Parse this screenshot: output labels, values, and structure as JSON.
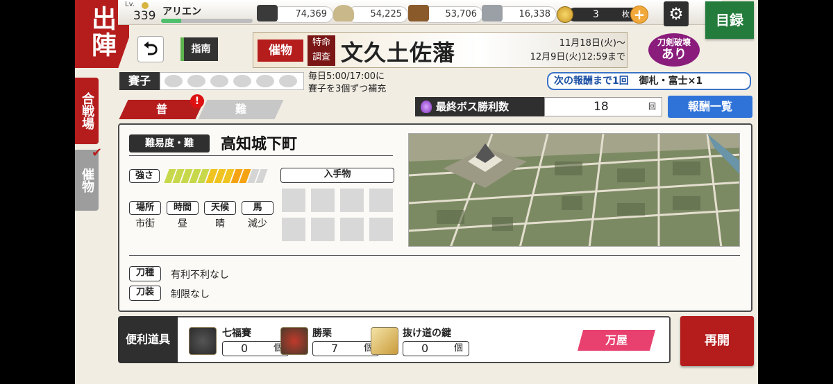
{
  "sidebar": {
    "sortie_label": "出陣",
    "tab_kassenba": "合戦場",
    "tab_saiji": "催物"
  },
  "player": {
    "lv_label": "Lv.",
    "level": "339",
    "name": "アリエン",
    "xp_fraction": 0.22
  },
  "resources": [
    {
      "icon": "charcoal-icon",
      "value": "74,369",
      "color": "#3a3a3a"
    },
    {
      "icon": "tamahagane-icon",
      "value": "54,225",
      "color": "#c9b88a"
    },
    {
      "icon": "cooling-material-icon",
      "value": "53,706",
      "color": "#8b5a2b"
    },
    {
      "icon": "whetstone-icon",
      "value": "16,338",
      "color": "#9aa0a6"
    }
  ],
  "koban": {
    "value": "3",
    "unit": "枚"
  },
  "header": {
    "catalog_label": "目録"
  },
  "nav": {
    "guide_label": "指南"
  },
  "event_banner": {
    "tag": "催物",
    "subtag_line1": "特命",
    "subtag_line2": "調査",
    "title": "文久土佐藩",
    "date_line1": "11月18日(火)〜",
    "date_line2": "12月9日(火)12:59まで"
  },
  "badge": {
    "line1": "刀剣破壊",
    "line2": "あり"
  },
  "saishi": {
    "label": "賽子",
    "count_slots": 6,
    "note_line1": "毎日5:00/17:00に",
    "note_line2": "賽子を3個ずつ補充"
  },
  "reward": {
    "next_label": "次の報酬まで1回",
    "next_item": "御札・富士×1",
    "boss_label": "最終ボス勝利数",
    "boss_value": "18",
    "boss_unit": "回",
    "list_button": "報酬一覧"
  },
  "difficulty_tabs": {
    "normal": "普",
    "hard": "難",
    "alert": "!"
  },
  "stage": {
    "difficulty_label": "難易度・難",
    "name": "高知城下町",
    "strength_label": "強さ",
    "strength_level": 0.8,
    "conditions": [
      {
        "label": "場所",
        "value": "市街"
      },
      {
        "label": "時間",
        "value": "昼"
      },
      {
        "label": "天候",
        "value": "晴"
      },
      {
        "label": "馬",
        "value": "減少"
      }
    ],
    "loot_label": "入手物",
    "sword_type_label": "刀種",
    "sword_type_value": "有利不利なし",
    "equip_label": "刀装",
    "equip_value": "制限なし"
  },
  "tools": {
    "label": "便利道具",
    "items": [
      {
        "name": "七福賽",
        "count": "0",
        "unit": "個",
        "icon": "shichifuku-dice-icon"
      },
      {
        "name": "勝栗",
        "count": "7",
        "unit": "個",
        "icon": "kachiguri-icon"
      },
      {
        "name": "抜け道の鍵",
        "count": "0",
        "unit": "個",
        "icon": "secret-key-icon"
      }
    ],
    "shop_label": "万屋"
  },
  "actions": {
    "resume_label": "再開"
  }
}
